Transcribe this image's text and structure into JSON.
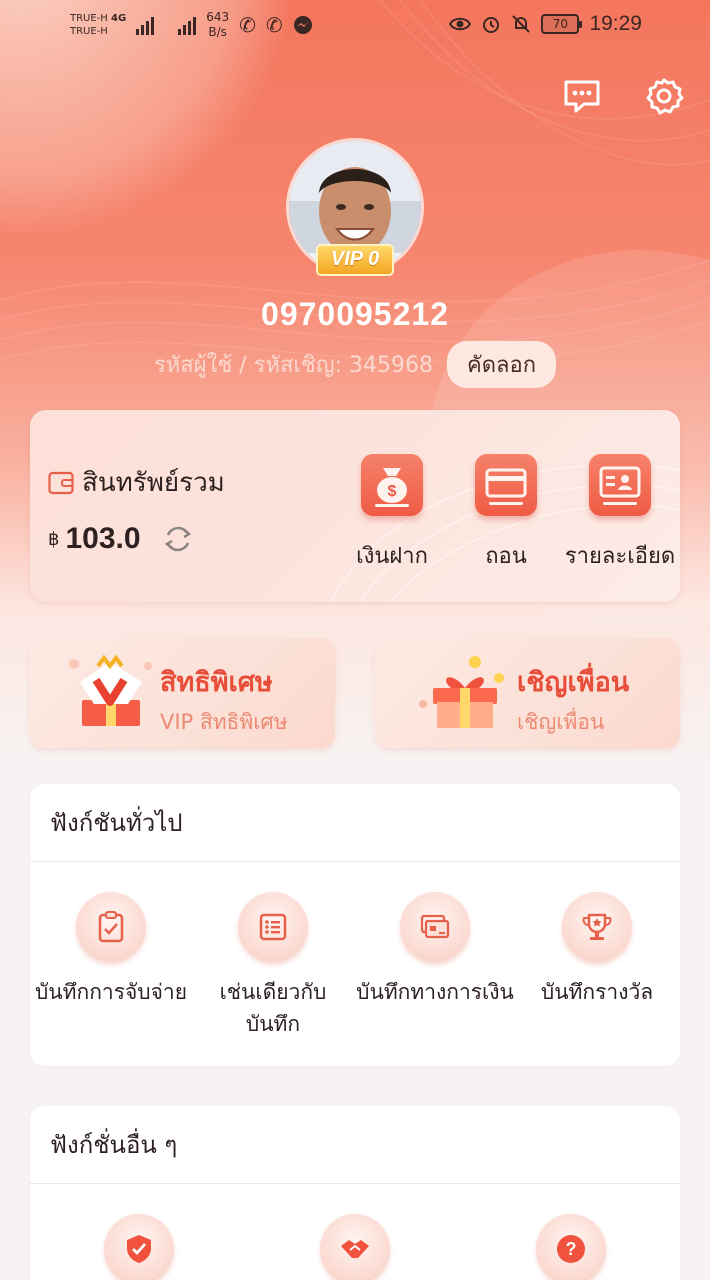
{
  "status_bar": {
    "carrier_1": "TRUE-H",
    "carrier_2": "TRUE-H",
    "network": "4G",
    "speed_value": "643",
    "speed_unit": "B/s",
    "battery": "70",
    "time": "19:29"
  },
  "header": {
    "message_icon": "chat-icon",
    "settings_icon": "gear-icon"
  },
  "profile": {
    "vip_badge": "VIP 0",
    "phone": "0970095212",
    "uid_text": "รหัสผู้ใช้ / รหัสเชิญ: 345968",
    "copy_label": "คัดลอก"
  },
  "assets": {
    "title": "สินทรัพย์รวม",
    "currency": "฿",
    "amount": "103.0",
    "actions": [
      {
        "label": "เงินฝาก",
        "icon": "money-bag-icon"
      },
      {
        "label": "ถอน",
        "icon": "card-icon"
      },
      {
        "label": "รายละเอียด",
        "icon": "id-card-icon"
      }
    ]
  },
  "promos": [
    {
      "title": "สิทธิพิเศษ",
      "subtitle": "VIP สิทธิพิเศษ",
      "icon": "vip-gift-icon"
    },
    {
      "title": "เชิญเพื่อน",
      "subtitle": "เชิญเพื่อน",
      "icon": "gift-box-icon"
    }
  ],
  "general": {
    "title": "ฟังก์ชันทั่วไป",
    "items": [
      {
        "label": "บันทึกการจับจ่าย",
        "icon": "clipboard-check-icon"
      },
      {
        "label": "เช่นเดียวกับบันทึก",
        "icon": "list-icon"
      },
      {
        "label": "บันทึกทางการเงิน",
        "icon": "cards-icon"
      },
      {
        "label": "บันทึกรางวัล",
        "icon": "trophy-icon"
      }
    ]
  },
  "others": {
    "title": "ฟังก์ชั่นอื่น ๆ",
    "items": [
      {
        "icon": "shield-check-icon"
      },
      {
        "icon": "handshake-icon"
      },
      {
        "icon": "help-icon"
      }
    ]
  },
  "colors": {
    "primary": "#f4765d",
    "accent": "#e84d3a",
    "vip_gold": "#f5a623"
  }
}
